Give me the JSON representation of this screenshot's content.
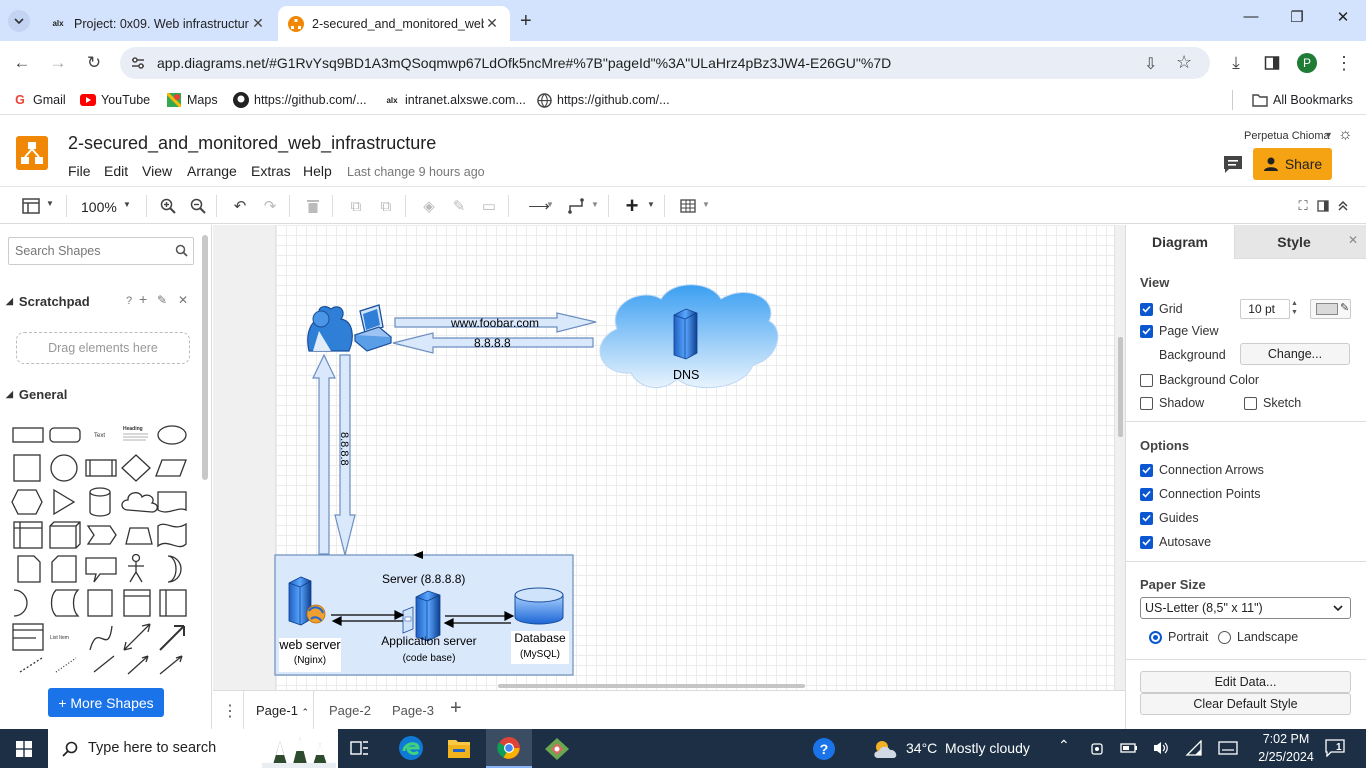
{
  "browser": {
    "tabs": [
      {
        "title": "Project: 0x09. Web infrastructur",
        "icon": "alx-icon",
        "active": false
      },
      {
        "title": "2-secured_and_monitored_web",
        "icon": "drawio-icon",
        "active": true
      }
    ],
    "url": "app.diagrams.net/#G1RvYsq9BD1A3mQSoqmwp67LdOfk5ncMre#%7B\"pageId\"%3A\"ULaHrz4pBz3JW4-E26GU\"%7D",
    "profile_initial": "P",
    "bookmarks": [
      {
        "label": "Gmail",
        "icon": "gmail-icon"
      },
      {
        "label": "YouTube",
        "icon": "youtube-icon"
      },
      {
        "label": "Maps",
        "icon": "maps-icon"
      },
      {
        "label": "https://github.com/...",
        "icon": "github-icon"
      },
      {
        "label": "intranet.alxswe.com...",
        "icon": "alx-icon"
      },
      {
        "label": "https://github.com/...",
        "icon": "globe-icon"
      }
    ],
    "all_bookmarks": "All Bookmarks"
  },
  "app": {
    "title": "2-secured_and_monitored_web_infrastructure",
    "menus": [
      "File",
      "Edit",
      "View",
      "Arrange",
      "Extras",
      "Help"
    ],
    "last_change": "Last change 9 hours ago",
    "user": "Perpetua Chioma",
    "share": "Share",
    "zoom": "100%"
  },
  "sidebar": {
    "search_placeholder": "Search Shapes",
    "scratchpad": "Scratchpad",
    "scratchpad_help": "?",
    "drag_hint": "Drag elements here",
    "general": "General",
    "more_shapes": "+ More Shapes"
  },
  "diagram": {
    "request_label": "www.foobar.com",
    "response_label": "8.8.8.8",
    "vertical_label": "8.8.8.8",
    "dns_label": "DNS",
    "server_label": "Server (8.8.8.8)",
    "web_server": "web server",
    "web_server_sub": "(Nginx)",
    "app_server": "Application server",
    "app_server_sub": "(code base)",
    "database": "Database",
    "database_sub": "(MySQL)"
  },
  "pages": [
    "Page-1",
    "Page-2",
    "Page-3"
  ],
  "panel": {
    "tab_diagram": "Diagram",
    "tab_style": "Style",
    "view_heading": "View",
    "grid": "Grid",
    "grid_size": "10 pt",
    "page_view": "Page View",
    "background": "Background",
    "change": "Change...",
    "background_color": "Background Color",
    "shadow": "Shadow",
    "sketch": "Sketch",
    "options_heading": "Options",
    "connection_arrows": "Connection Arrows",
    "connection_points": "Connection Points",
    "guides": "Guides",
    "autosave": "Autosave",
    "paper_size_heading": "Paper Size",
    "paper_size": "US-Letter (8,5\" x 11\")",
    "portrait": "Portrait",
    "landscape": "Landscape",
    "edit_data": "Edit Data...",
    "clear_default_style": "Clear Default Style"
  },
  "taskbar": {
    "search_placeholder": "Type here to search",
    "weather": "34°C  Mostly cloudy",
    "time": "7:02 PM",
    "date": "2/25/2024",
    "notifications": "1"
  },
  "colors": {
    "chrome_tabbar": "#d3e3fd",
    "drawio_orange": "#f08705",
    "share_button": "#f5a213",
    "accent_blue": "#1a73e8",
    "taskbar": "#1c2f45"
  }
}
